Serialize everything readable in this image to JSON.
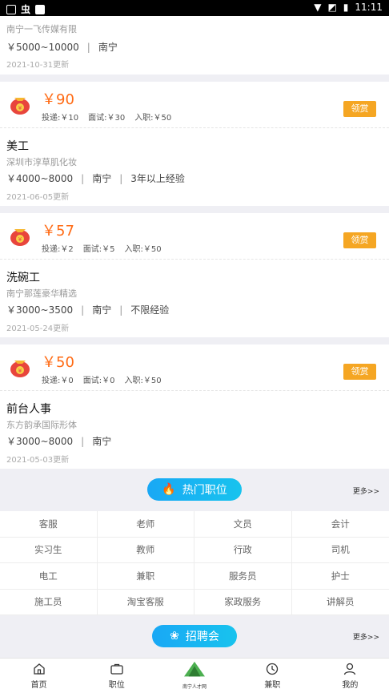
{
  "status": {
    "time": "11:11"
  },
  "top_card": {
    "company": "南宁一飞传媒有限",
    "salary": "￥5000~10000",
    "city": "南宁",
    "date": "2021-10-31更新"
  },
  "jobs": [
    {
      "amount": "￥90",
      "deliver": "投递:￥10",
      "interview": "面试:￥30",
      "onboard": "入职:￥50",
      "claim": "领赏",
      "title": "美工",
      "company": "深圳市淳草肌化妆",
      "salary": "￥4000~8000",
      "city": "南宁",
      "extra": "3年以上经验",
      "date": "2021-06-05更新"
    },
    {
      "amount": "￥57",
      "deliver": "投递:￥2",
      "interview": "面试:￥5",
      "onboard": "入职:￥50",
      "claim": "领赏",
      "title": "洗碗工",
      "company": "南宁那莲豪华精选",
      "salary": "￥3000~3500",
      "city": "南宁",
      "extra": "不限经验",
      "date": "2021-05-24更新"
    },
    {
      "amount": "￥50",
      "deliver": "投递:￥0",
      "interview": "面试:￥0",
      "onboard": "入职:￥50",
      "claim": "领赏",
      "title": "前台人事",
      "company": "东方韵承国际形体",
      "salary": "￥3000~8000",
      "city": "南宁",
      "extra": "",
      "date": "2021-05-03更新"
    }
  ],
  "hot": {
    "label": "热门职位",
    "more": "更多>>",
    "items": [
      "客服",
      "老师",
      "文员",
      "会计",
      "实习生",
      "教师",
      "行政",
      "司机",
      "电工",
      "兼职",
      "服务员",
      "护士",
      "施工员",
      "淘宝客服",
      "家政服务",
      "讲解员"
    ]
  },
  "fair": {
    "label": "招聘会",
    "more": "更多>>"
  },
  "tabs": {
    "home": "首页",
    "jobs": "职位",
    "center": "南宁人才网",
    "parttime": "兼职",
    "mine": "我的"
  },
  "colors": {
    "accent": "#ff6a13",
    "claim": "#f5a623",
    "pill": "#19a8f5"
  }
}
